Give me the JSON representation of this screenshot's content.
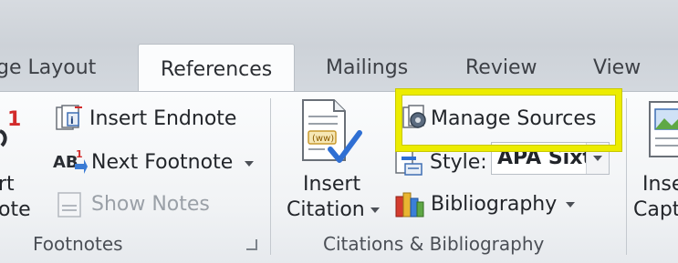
{
  "tabs": [
    {
      "label": "ge Layout",
      "active": false
    },
    {
      "label": "References",
      "active": true
    },
    {
      "label": "Mailings",
      "active": false
    },
    {
      "label": "Review",
      "active": false
    },
    {
      "label": "View",
      "active": false
    }
  ],
  "footnotes_group": {
    "label": "Footnotes",
    "insert_footnote_partial": [
      "rt",
      "ote"
    ],
    "insert_endnote": "Insert Endnote",
    "next_footnote": "Next Footnote",
    "show_notes": "Show Notes",
    "next_footnote_prefix": "AB"
  },
  "citations_group": {
    "label": "Citations & Bibliography",
    "insert_citation_line1": "Insert",
    "insert_citation_line2": "Citation",
    "manage_sources": "Manage Sources",
    "style_label": "Style:",
    "style_value": "APA Sixtl",
    "bibliography": "Bibliography"
  },
  "captions_group": {
    "insert_caption_partial": [
      "Inse",
      "Capt"
    ]
  },
  "colors": {
    "highlight": "#ecec00",
    "footnote_red": "#d22b2b"
  }
}
